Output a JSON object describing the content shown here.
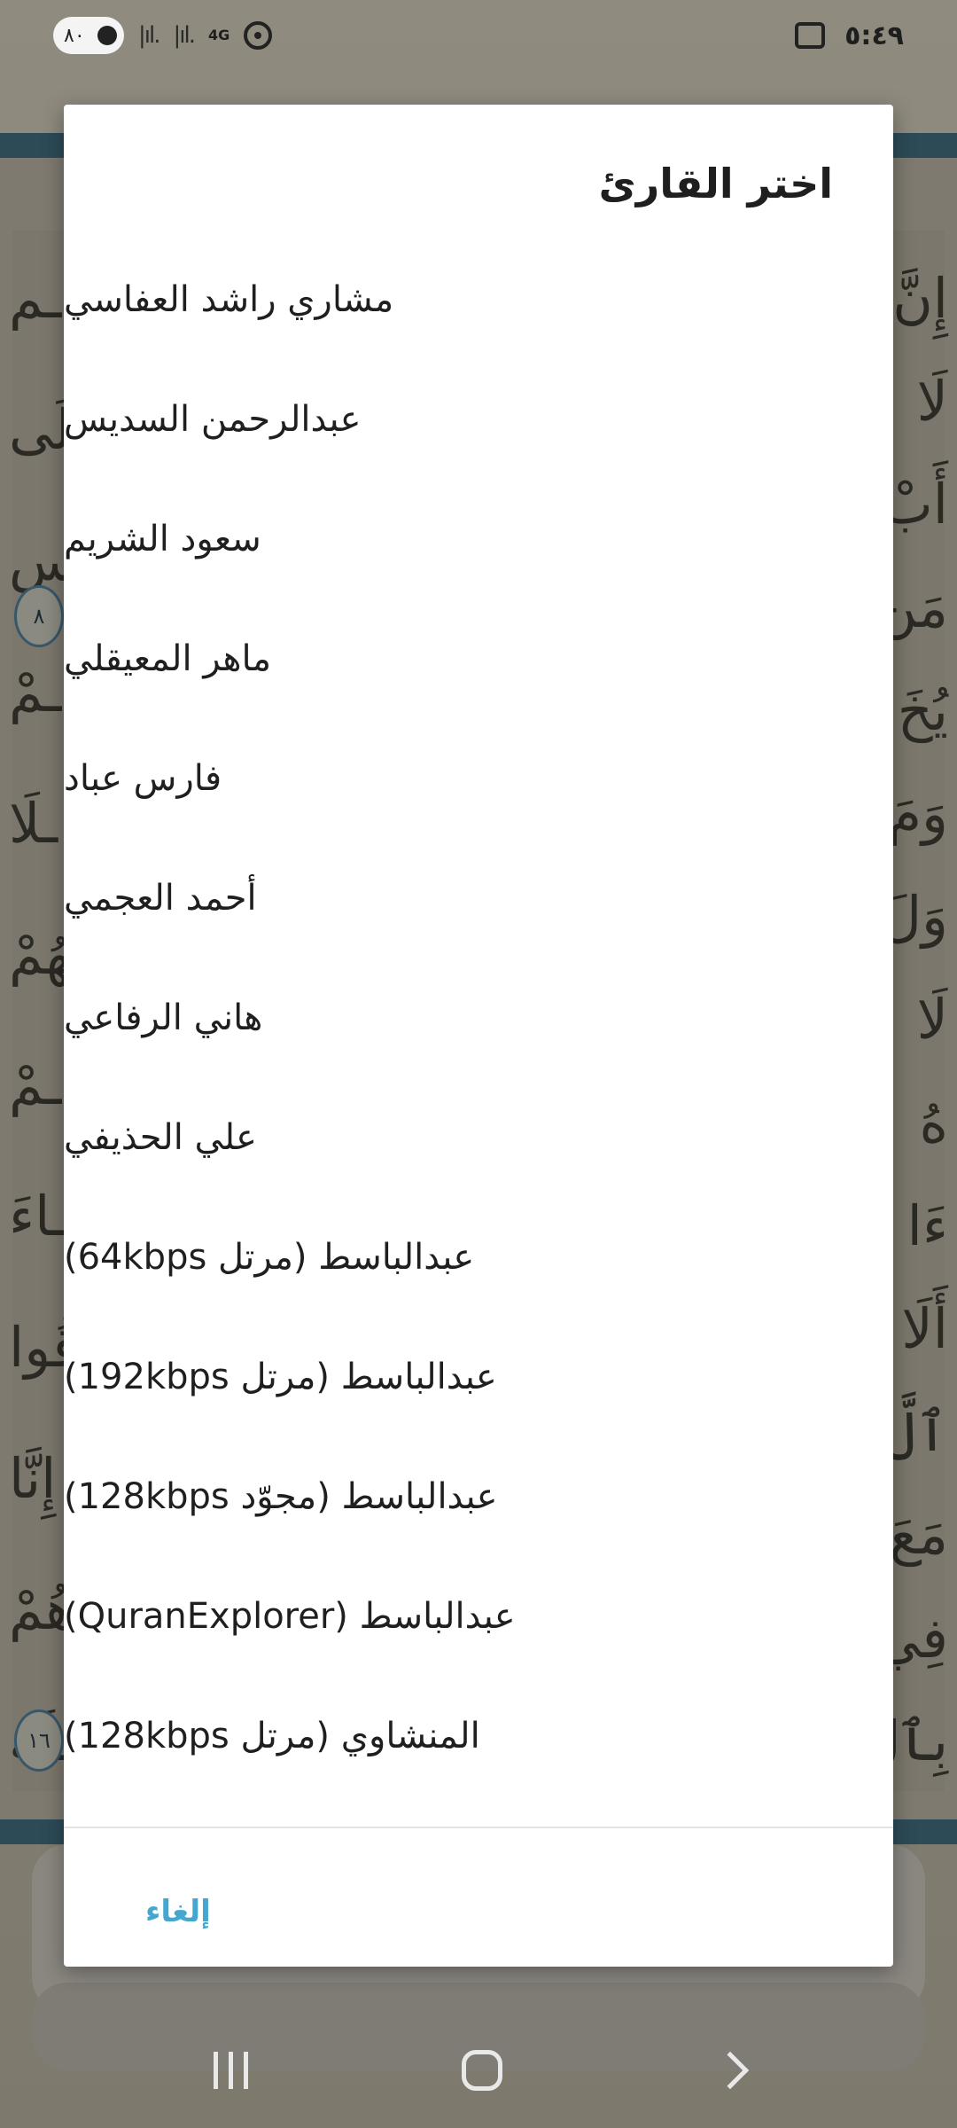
{
  "status_bar": {
    "battery": "٨٠",
    "network": "4G",
    "time": "٥:٤٩"
  },
  "dialog": {
    "title": "اختر القارئ",
    "reciters": [
      "مشاري راشد العفاسي",
      "عبدالرحمن السديس",
      "سعود الشريم",
      "ماهر المعيقلي",
      "فارس عباد",
      "أحمد العجمي",
      "هاني الرفاعي",
      "علي الحذيفي",
      "عبدالباسط (مرتل 64kbps)",
      "عبدالباسط (مرتل 192kbps)",
      "عبدالباسط (مجوّد 128kbps)",
      "عبدالباسط (QuranExplorer)",
      "المنشاوي (مرتل 128kbps)"
    ],
    "cancel_label": "إلغاء"
  },
  "background": {
    "verse_markers": [
      "٨",
      "١٦"
    ]
  },
  "colors": {
    "accent": "#45a7cf",
    "frame": "#2c4b57",
    "dialog_bg": "#ffffff"
  },
  "icons": {
    "recents": "recents-icon",
    "home": "home-icon",
    "back": "back-icon"
  }
}
